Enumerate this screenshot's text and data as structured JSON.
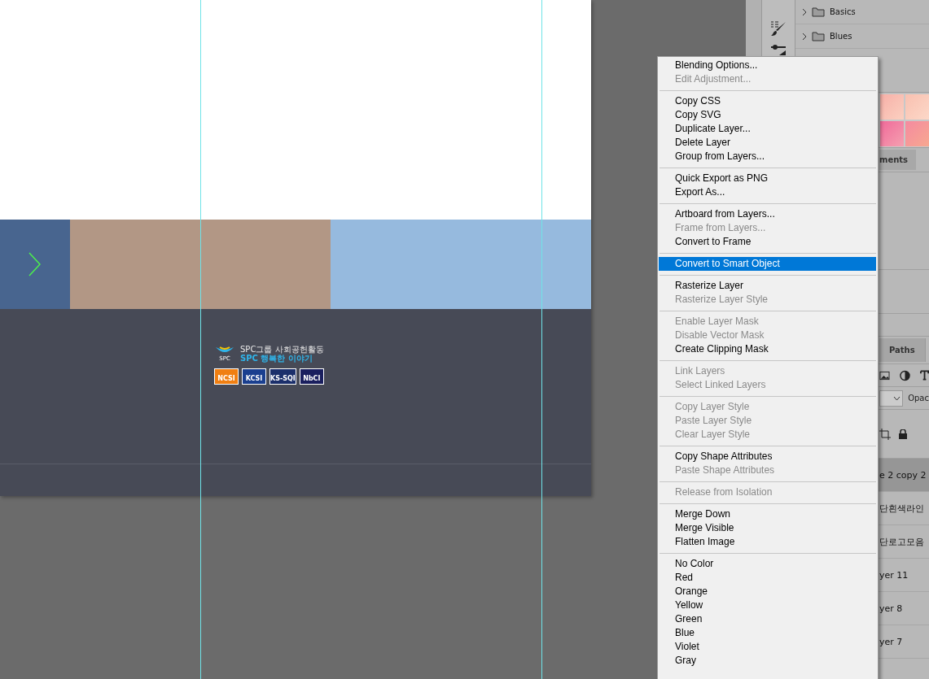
{
  "document": {
    "footer": {
      "logo_caption": "SPC",
      "tagline": "SPC그룹 사회공헌활동",
      "title": "SPC 행복한 이야기",
      "badges": [
        "NCSI",
        "KCSI",
        "KS-SQI",
        "NbCI"
      ]
    }
  },
  "swatches": {
    "folders": [
      {
        "label": "Basics",
        "expanded": false
      },
      {
        "label": "Blues",
        "expanded": false
      }
    ]
  },
  "adjustments_tab": {
    "label": "ments"
  },
  "layers_panel": {
    "tab": "Paths",
    "opacity_label": "Opac",
    "layers": [
      {
        "name": "e 2 copy 2",
        "selected": true
      },
      {
        "name": "단흰색라인",
        "selected": false
      },
      {
        "name": "단로고모음",
        "selected": false
      },
      {
        "name": "yer 11",
        "selected": false
      },
      {
        "name": "yer 8",
        "selected": false
      },
      {
        "name": "yer 7",
        "selected": false
      }
    ]
  },
  "context_menu": {
    "groups": [
      [
        {
          "label": "Blending Options...",
          "disabled": false,
          "selected": false
        },
        {
          "label": "Edit Adjustment...",
          "disabled": true,
          "selected": false
        }
      ],
      [
        {
          "label": "Copy CSS",
          "disabled": false,
          "selected": false
        },
        {
          "label": "Copy SVG",
          "disabled": false,
          "selected": false
        },
        {
          "label": "Duplicate Layer...",
          "disabled": false,
          "selected": false
        },
        {
          "label": "Delete Layer",
          "disabled": false,
          "selected": false
        },
        {
          "label": "Group from Layers...",
          "disabled": false,
          "selected": false
        }
      ],
      [
        {
          "label": "Quick Export as PNG",
          "disabled": false,
          "selected": false
        },
        {
          "label": "Export As...",
          "disabled": false,
          "selected": false
        }
      ],
      [
        {
          "label": "Artboard from Layers...",
          "disabled": false,
          "selected": false
        },
        {
          "label": "Frame from Layers...",
          "disabled": true,
          "selected": false
        },
        {
          "label": "Convert to Frame",
          "disabled": false,
          "selected": false
        }
      ],
      [
        {
          "label": "Convert to Smart Object",
          "disabled": false,
          "selected": true
        }
      ],
      [
        {
          "label": "Rasterize Layer",
          "disabled": false,
          "selected": false
        },
        {
          "label": "Rasterize Layer Style",
          "disabled": true,
          "selected": false
        }
      ],
      [
        {
          "label": "Enable Layer Mask",
          "disabled": true,
          "selected": false
        },
        {
          "label": "Disable Vector Mask",
          "disabled": true,
          "selected": false
        },
        {
          "label": "Create Clipping Mask",
          "disabled": false,
          "selected": false
        }
      ],
      [
        {
          "label": "Link Layers",
          "disabled": true,
          "selected": false
        },
        {
          "label": "Select Linked Layers",
          "disabled": true,
          "selected": false
        }
      ],
      [
        {
          "label": "Copy Layer Style",
          "disabled": true,
          "selected": false
        },
        {
          "label": "Paste Layer Style",
          "disabled": true,
          "selected": false
        },
        {
          "label": "Clear Layer Style",
          "disabled": true,
          "selected": false
        }
      ],
      [
        {
          "label": "Copy Shape Attributes",
          "disabled": false,
          "selected": false
        },
        {
          "label": "Paste Shape Attributes",
          "disabled": true,
          "selected": false
        }
      ],
      [
        {
          "label": "Release from Isolation",
          "disabled": true,
          "selected": false
        }
      ],
      [
        {
          "label": "Merge Down",
          "disabled": false,
          "selected": false
        },
        {
          "label": "Merge Visible",
          "disabled": false,
          "selected": false
        },
        {
          "label": "Flatten Image",
          "disabled": false,
          "selected": false
        }
      ],
      [
        {
          "label": "No Color",
          "disabled": false,
          "selected": false
        },
        {
          "label": "Red",
          "disabled": false,
          "selected": false
        },
        {
          "label": "Orange",
          "disabled": false,
          "selected": false
        },
        {
          "label": "Yellow",
          "disabled": false,
          "selected": false
        },
        {
          "label": "Green",
          "disabled": false,
          "selected": false
        },
        {
          "label": "Blue",
          "disabled": false,
          "selected": false
        },
        {
          "label": "Violet",
          "disabled": false,
          "selected": false
        },
        {
          "label": "Gray",
          "disabled": false,
          "selected": false
        }
      ]
    ]
  }
}
